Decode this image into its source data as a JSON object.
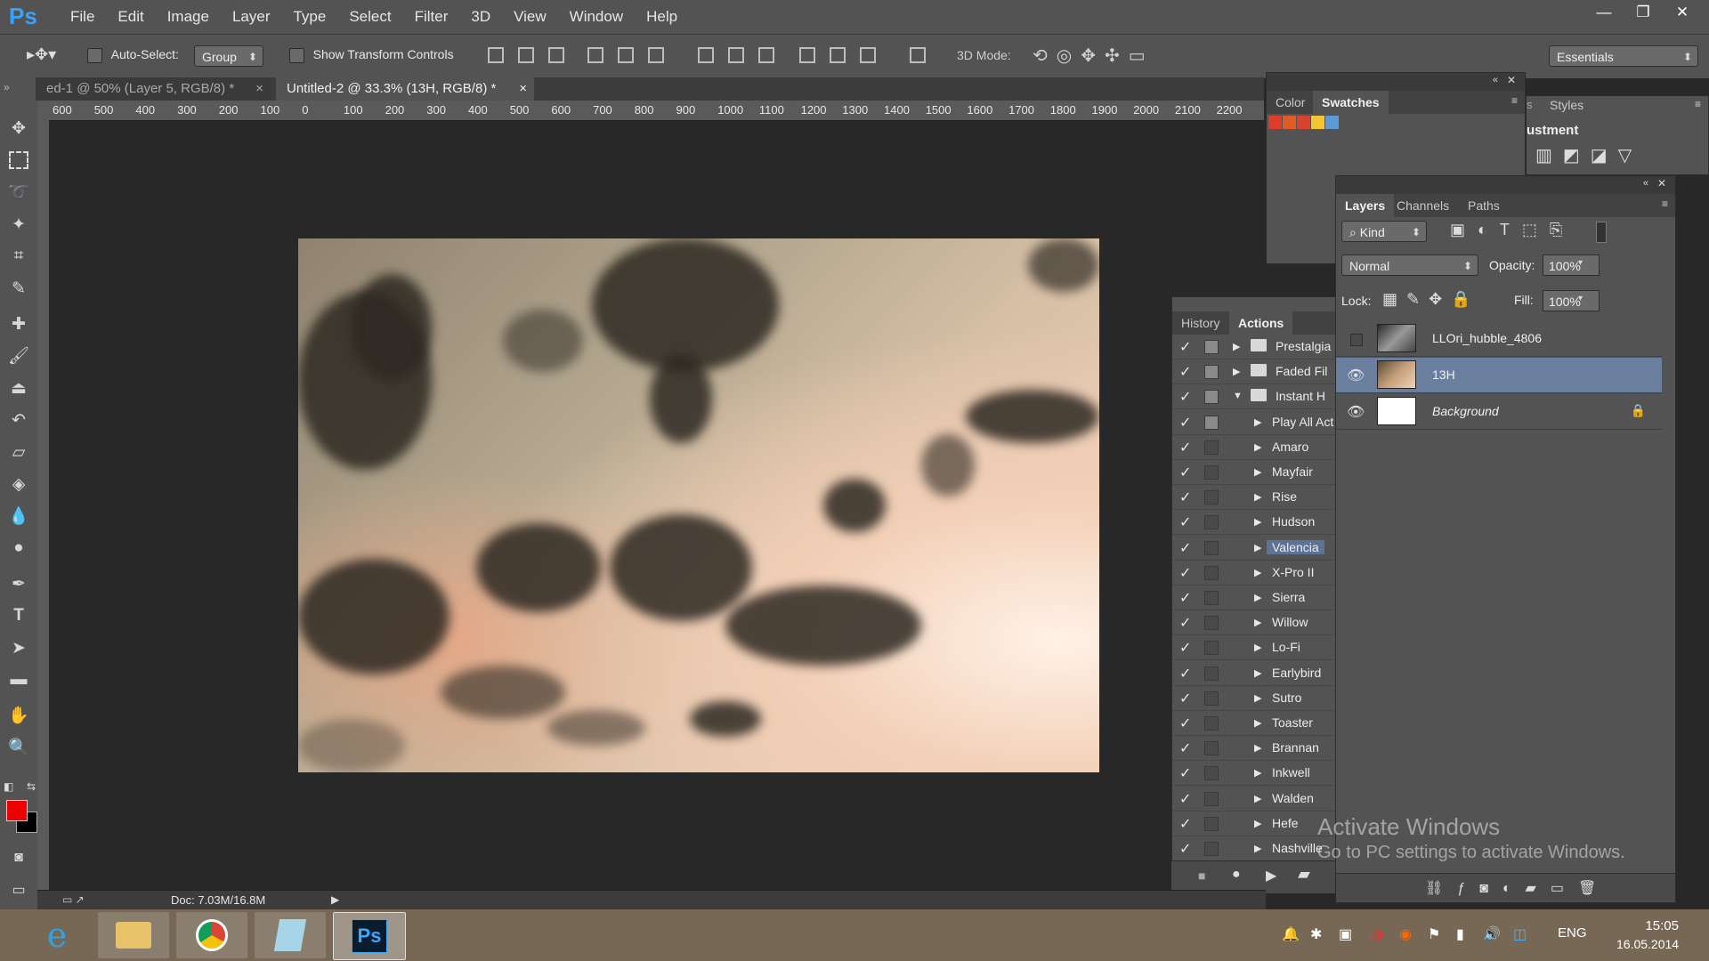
{
  "app": {
    "logo": "Ps"
  },
  "menu": [
    "File",
    "Edit",
    "Image",
    "Layer",
    "Type",
    "Select",
    "Filter",
    "3D",
    "View",
    "Window",
    "Help"
  ],
  "window_buttons": {
    "minimize": "—",
    "restore": "❐",
    "close": "✕"
  },
  "options": {
    "auto_select_label": "Auto-Select:",
    "auto_select_value": "Group",
    "show_transform_label": "Show Transform Controls",
    "mode_3d_label": "3D Mode:",
    "workspace": "Essentials"
  },
  "doc_tabs": [
    {
      "label": "ed-1 @ 50% (Layer 5, RGB/8) *"
    },
    {
      "label": "Untitled-2 @ 33.3% (13H, RGB/8) *"
    }
  ],
  "ruler_labels": [
    "600",
    "500",
    "400",
    "300",
    "200",
    "100",
    "0",
    "100",
    "200",
    "300",
    "400",
    "500",
    "600",
    "700",
    "800",
    "900",
    "1000",
    "1100",
    "1200",
    "1300",
    "1400",
    "1500",
    "1600",
    "1700",
    "1800",
    "1900",
    "2000",
    "2100",
    "2200"
  ],
  "color_panel": {
    "tabs": [
      "Color",
      "Swatches"
    ],
    "swatches": [
      "#e03c2a",
      "#e05a2a",
      "#d9432e",
      "#f5c531",
      "#5b9bd5"
    ]
  },
  "styles_panel": {
    "tab": "Styles",
    "heading": "ustment"
  },
  "actions_panel": {
    "tabs": [
      "History",
      "Actions"
    ],
    "rows": [
      {
        "label": "Prestalgia",
        "type": "set",
        "expanded": false
      },
      {
        "label": "Faded Fil",
        "type": "set",
        "expanded": false
      },
      {
        "label": "Instant H",
        "type": "set",
        "expanded": true
      },
      {
        "label": "Play All Act",
        "type": "action"
      },
      {
        "label": "Amaro",
        "type": "action"
      },
      {
        "label": "Mayfair",
        "type": "action"
      },
      {
        "label": "Rise",
        "type": "action"
      },
      {
        "label": "Hudson",
        "type": "action"
      },
      {
        "label": "Valencia",
        "type": "action",
        "selected": true
      },
      {
        "label": "X-Pro II",
        "type": "action"
      },
      {
        "label": "Sierra",
        "type": "action"
      },
      {
        "label": "Willow",
        "type": "action"
      },
      {
        "label": "Lo-Fi",
        "type": "action"
      },
      {
        "label": "Earlybird",
        "type": "action"
      },
      {
        "label": "Sutro",
        "type": "action"
      },
      {
        "label": "Toaster",
        "type": "action"
      },
      {
        "label": "Brannan",
        "type": "action"
      },
      {
        "label": "Inkwell",
        "type": "action"
      },
      {
        "label": "Walden",
        "type": "action"
      },
      {
        "label": "Hefe",
        "type": "action"
      },
      {
        "label": "Nashville",
        "type": "action"
      }
    ]
  },
  "layers_panel": {
    "tabs": [
      "Layers",
      "Channels",
      "Paths"
    ],
    "filter_kind": "Kind",
    "blend_mode": "Normal",
    "opacity_label": "Opacity:",
    "opacity_value": "100%",
    "lock_label": "Lock:",
    "fill_label": "Fill:",
    "fill_value": "100%",
    "layers": [
      {
        "name": "LLOri_hubble_4806",
        "visible": false
      },
      {
        "name": "13H",
        "visible": true,
        "selected": true
      },
      {
        "name": "Background",
        "visible": true,
        "locked": true
      }
    ]
  },
  "status": {
    "doc_info": "Doc: 7.03M/16.8M"
  },
  "watermark": {
    "line1": "Activate Windows",
    "line2": "Go to PC settings to activate Windows."
  },
  "taskbar": {
    "lang": "ENG",
    "time": "15:05",
    "date": "16.05.2014"
  }
}
